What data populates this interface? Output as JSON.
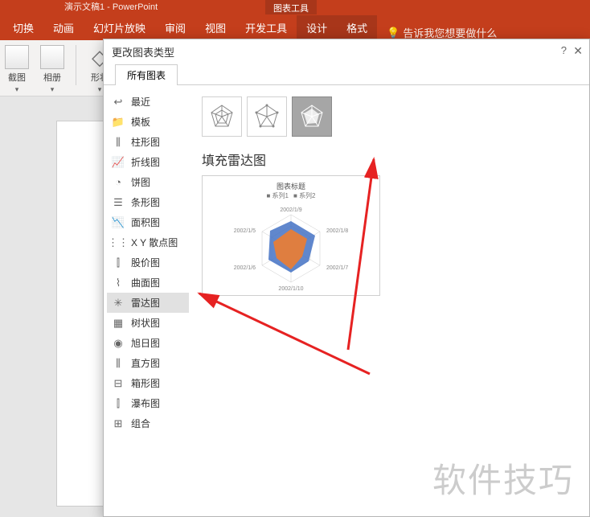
{
  "app": {
    "title": "演示文稿1 - PowerPoint"
  },
  "ribbon": {
    "context_label": "图表工具",
    "tabs": [
      "切换",
      "动画",
      "幻灯片放映",
      "审阅",
      "视图",
      "开发工具",
      "设计",
      "格式"
    ],
    "tell_me": "告诉我您想要做什么"
  },
  "tools": {
    "crop": "截图",
    "album": "相册",
    "shapes": "形状"
  },
  "dialog": {
    "title": "更改图表类型",
    "tab": "所有图表",
    "sidebar": [
      {
        "icon": "↩",
        "label": "最近"
      },
      {
        "icon": "📁",
        "label": "模板"
      },
      {
        "icon": "⫼",
        "label": "柱形图"
      },
      {
        "icon": "📈",
        "label": "折线图"
      },
      {
        "icon": "◔",
        "label": "饼图"
      },
      {
        "icon": "☰",
        "label": "条形图"
      },
      {
        "icon": "📉",
        "label": "面积图"
      },
      {
        "icon": "⋮⋮",
        "label": "X Y 散点图"
      },
      {
        "icon": "⫿",
        "label": "股价图"
      },
      {
        "icon": "⌇",
        "label": "曲面图"
      },
      {
        "icon": "✳",
        "label": "雷达图"
      },
      {
        "icon": "▦",
        "label": "树状图"
      },
      {
        "icon": "◉",
        "label": "旭日图"
      },
      {
        "icon": "⫼",
        "label": "直方图"
      },
      {
        "icon": "⊟",
        "label": "箱形图"
      },
      {
        "icon": "⫿",
        "label": "瀑布图"
      },
      {
        "icon": "⊞",
        "label": "组合"
      }
    ],
    "selected_index": 10,
    "chart_name": "填充雷达图",
    "preview": {
      "title": "图表标题",
      "legend": [
        "系列1",
        "系列2"
      ],
      "axes": [
        "2002/1/9",
        "2002/1/8",
        "2002/1/7",
        "2002/1/10",
        "2002/1/6",
        "2002/1/5"
      ]
    }
  },
  "watermark": "软件技巧",
  "chart_data": {
    "type": "radar",
    "subtype": "filled",
    "categories": [
      "2002/1/5",
      "2002/1/6",
      "2002/1/7",
      "2002/1/8",
      "2002/1/9",
      "2002/1/10"
    ],
    "series": [
      {
        "name": "系列1",
        "values": [
          40,
          35,
          25,
          45,
          30,
          38
        ],
        "color": "#4472c4"
      },
      {
        "name": "系列2",
        "values": [
          30,
          25,
          20,
          28,
          35,
          22
        ],
        "color": "#ed7d31"
      }
    ],
    "title": "图表标题"
  }
}
